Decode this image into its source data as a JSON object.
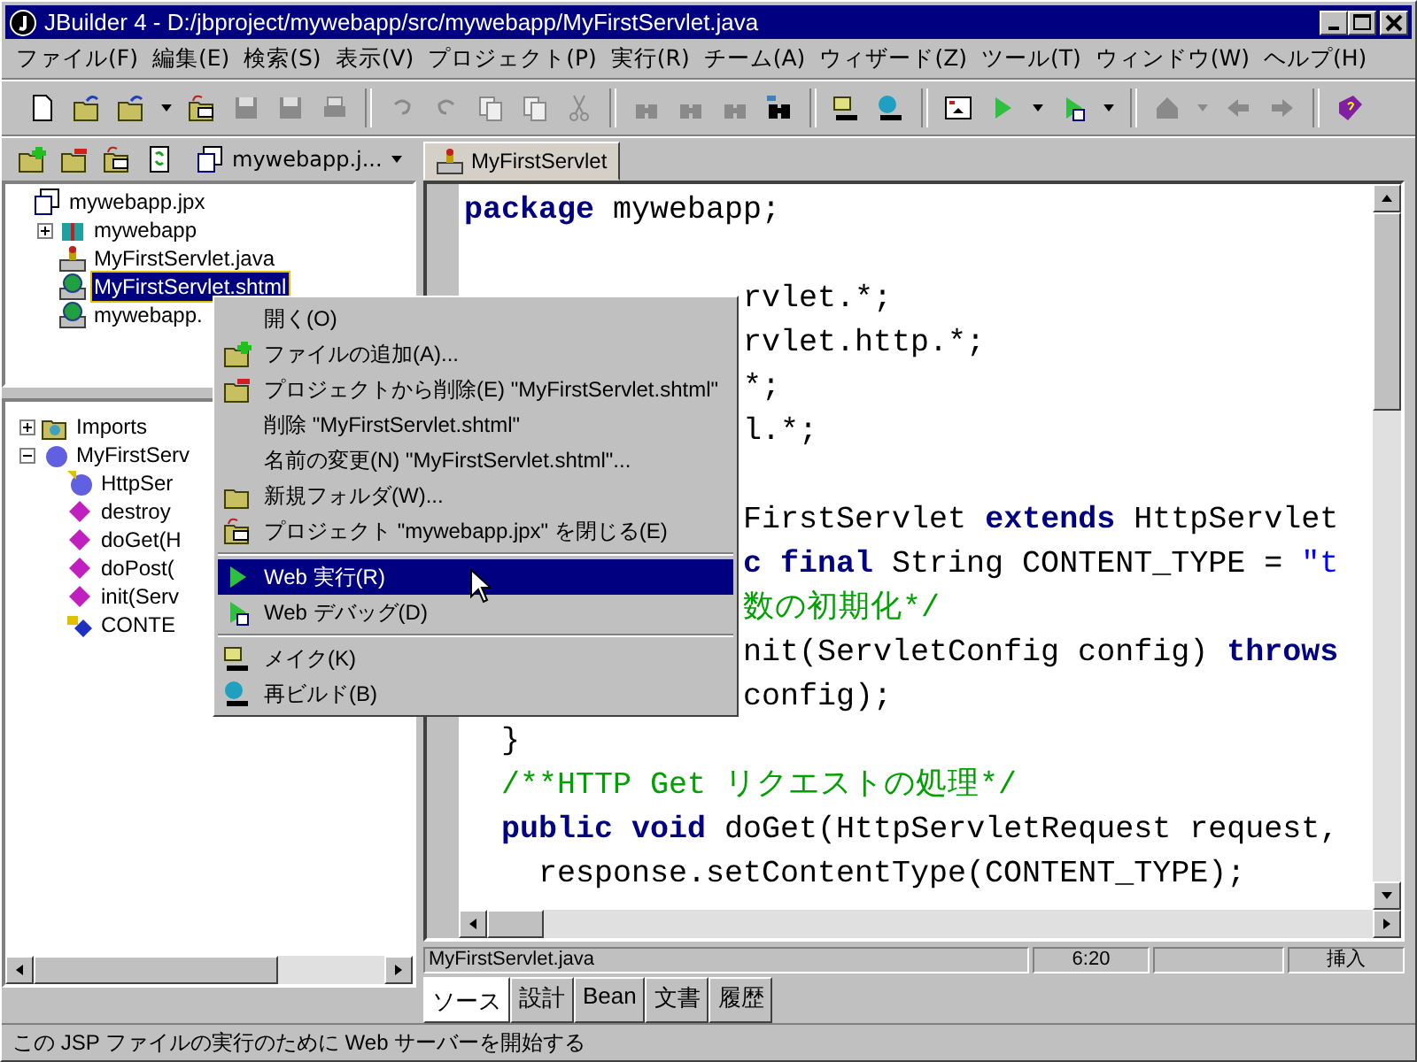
{
  "window": {
    "title": "JBuilder 4 - D:/jbproject/mywebapp/src/mywebapp/MyFirstServlet.java"
  },
  "menu_bar": [
    "ファイル(F)",
    "編集(E)",
    "検索(S)",
    "表示(V)",
    "プロジェクト(P)",
    "実行(R)",
    "チーム(A)",
    "ウィザード(Z)",
    "ツール(T)",
    "ウィンドウ(W)",
    "ヘルプ(H)"
  ],
  "toolbar": [
    {
      "kind": "new-file",
      "disabled": false
    },
    {
      "kind": "open",
      "disabled": false
    },
    {
      "kind": "reopen",
      "disabled": false,
      "dropdown": true
    },
    {
      "kind": "close-project",
      "disabled": false
    },
    {
      "kind": "save",
      "disabled": true
    },
    {
      "kind": "save-all",
      "disabled": true
    },
    {
      "kind": "print",
      "disabled": true
    },
    {
      "kind": "separator"
    },
    {
      "kind": "undo",
      "disabled": true
    },
    {
      "kind": "redo",
      "disabled": true
    },
    {
      "kind": "copy",
      "disabled": true
    },
    {
      "kind": "paste",
      "disabled": true
    },
    {
      "kind": "cut",
      "disabled": true
    },
    {
      "kind": "separator"
    },
    {
      "kind": "find",
      "disabled": true
    },
    {
      "kind": "find-again",
      "disabled": true
    },
    {
      "kind": "find-help",
      "disabled": true
    },
    {
      "kind": "browse",
      "disabled": false
    },
    {
      "kind": "separator"
    },
    {
      "kind": "make",
      "disabled": false
    },
    {
      "kind": "rebuild",
      "disabled": false
    },
    {
      "kind": "separator"
    },
    {
      "kind": "layout",
      "disabled": false
    },
    {
      "kind": "run",
      "disabled": false,
      "dropdown": true
    },
    {
      "kind": "debug",
      "disabled": false,
      "dropdown": true
    },
    {
      "kind": "separator"
    },
    {
      "kind": "home",
      "disabled": true,
      "dropdown": true
    },
    {
      "kind": "back",
      "disabled": true
    },
    {
      "kind": "forward",
      "disabled": true
    },
    {
      "kind": "separator"
    },
    {
      "kind": "help-book",
      "disabled": false
    }
  ],
  "project_toolbar": {
    "buttons": [
      {
        "kind": "add-file"
      },
      {
        "kind": "remove-file"
      },
      {
        "kind": "close-project"
      },
      {
        "kind": "refresh"
      }
    ],
    "project_selector": "mywebapp.j..."
  },
  "editor_tabs": [
    {
      "label": "MyFirstServlet",
      "selected": true
    }
  ],
  "project_tree": [
    {
      "label": "mywebapp.jpx",
      "kind": "project",
      "selected": false,
      "children": [
        {
          "label": "mywebapp",
          "kind": "package",
          "selected": false,
          "expanded": false
        },
        {
          "label": "MyFirstServlet.java",
          "kind": "servlet",
          "selected": false
        },
        {
          "label": "MyFirstServlet.shtml",
          "kind": "web",
          "selected": true
        },
        {
          "label": "mywebapp.",
          "kind": "web",
          "selected": false
        }
      ]
    }
  ],
  "structure_tree": [
    {
      "label": "Imports",
      "kind": "imports",
      "expanded": false
    },
    {
      "label": "MyFirstServ",
      "kind": "class",
      "expanded": true,
      "children": [
        {
          "label": "HttpSer",
          "kind": "superclass"
        },
        {
          "label": "destroy",
          "kind": "method"
        },
        {
          "label": "doGet(H",
          "kind": "method"
        },
        {
          "label": "doPost(",
          "kind": "method"
        },
        {
          "label": "init(Serv",
          "kind": "method"
        },
        {
          "label": "CONTE",
          "kind": "field"
        }
      ]
    }
  ],
  "editor": {
    "lines": [
      {
        "kind": "code",
        "tokens": [
          {
            "kind": "keyword",
            "text": "package"
          },
          {
            "kind": "plain",
            "text": " mywebapp;"
          }
        ]
      },
      {
        "kind": "blank"
      },
      {
        "kind": "code",
        "tokens": [
          {
            "kind": "plain",
            "text": "               rvlet.*;"
          }
        ]
      },
      {
        "kind": "code",
        "tokens": [
          {
            "kind": "plain",
            "text": "               rvlet.http.*;"
          }
        ]
      },
      {
        "kind": "code",
        "tokens": [
          {
            "kind": "plain",
            "text": "               *;"
          }
        ]
      },
      {
        "kind": "code",
        "tokens": [
          {
            "kind": "plain",
            "text": "               l.*;"
          }
        ]
      },
      {
        "kind": "blank"
      },
      {
        "kind": "code",
        "tokens": [
          {
            "kind": "plain",
            "text": "               FirstServlet "
          },
          {
            "kind": "keyword",
            "text": "extends"
          },
          {
            "kind": "plain",
            "text": " HttpServlet"
          }
        ]
      },
      {
        "kind": "code",
        "tokens": [
          {
            "kind": "keyword",
            "text": "               c final"
          },
          {
            "kind": "plain",
            "text": " String CONTENT_TYPE = "
          },
          {
            "kind": "string",
            "text": "\"t"
          }
        ]
      },
      {
        "kind": "code",
        "tokens": [
          {
            "kind": "comment",
            "text": "               数の初期化*/"
          }
        ]
      },
      {
        "kind": "code",
        "tokens": [
          {
            "kind": "plain",
            "text": "               nit(ServletConfig config) "
          },
          {
            "kind": "keyword",
            "text": "throws"
          }
        ]
      },
      {
        "kind": "code",
        "tokens": [
          {
            "kind": "plain",
            "text": "               config);"
          }
        ]
      },
      {
        "kind": "code",
        "tokens": [
          {
            "kind": "plain",
            "text": "  }"
          }
        ]
      },
      {
        "kind": "code",
        "tokens": [
          {
            "kind": "comment",
            "text": "  /**HTTP Get リクエストの処理*/"
          }
        ]
      },
      {
        "kind": "code",
        "tokens": [
          {
            "kind": "keyword",
            "text": "  public void"
          },
          {
            "kind": "plain",
            "text": " doGet(HttpServletRequest request,"
          }
        ]
      },
      {
        "kind": "code",
        "tokens": [
          {
            "kind": "plain",
            "text": "    response.setContentType(CONTENT_TYPE);"
          }
        ]
      }
    ]
  },
  "editor_status": {
    "file": "MyFirstServlet.java",
    "position": "6:20",
    "mode": "挿入"
  },
  "view_tabs": [
    {
      "label": "ソース",
      "selected": true
    },
    {
      "label": "設計",
      "selected": false
    },
    {
      "label": "Bean",
      "selected": false
    },
    {
      "label": "文書",
      "selected": false
    },
    {
      "label": "履歴",
      "selected": false
    }
  ],
  "context_menu": {
    "items": [
      {
        "label": "開く(O)",
        "kind": "plain",
        "selected": false,
        "separator_before": false
      },
      {
        "label": "ファイルの追加(A)...",
        "kind": "add-file",
        "selected": false,
        "separator_before": false
      },
      {
        "label": "プロジェクトから削除(E) \"MyFirstServlet.shtml\"",
        "kind": "remove-file",
        "selected": false,
        "separator_before": false
      },
      {
        "label": "削除 \"MyFirstServlet.shtml\"",
        "kind": "plain",
        "selected": false,
        "separator_before": false
      },
      {
        "label": "名前の変更(N) \"MyFirstServlet.shtml\"...",
        "kind": "plain",
        "selected": false,
        "separator_before": false
      },
      {
        "label": "新規フォルダ(W)...",
        "kind": "folder",
        "selected": false,
        "separator_before": false
      },
      {
        "label": "プロジェクト \"mywebapp.jpx\" を閉じる(E)",
        "kind": "close-project",
        "selected": false,
        "separator_before": false
      },
      {
        "label": "Web 実行(R)",
        "kind": "run",
        "selected": true,
        "separator_before": true
      },
      {
        "label": "Web デバッグ(D)",
        "kind": "debug",
        "selected": false,
        "separator_before": false
      },
      {
        "label": "メイク(K)",
        "kind": "make",
        "selected": false,
        "separator_before": true
      },
      {
        "label": "再ビルド(B)",
        "kind": "rebuild",
        "selected": false,
        "separator_before": false
      }
    ]
  },
  "status_bar": "この JSP ファイルの実行のために Web サーバーを開始する"
}
